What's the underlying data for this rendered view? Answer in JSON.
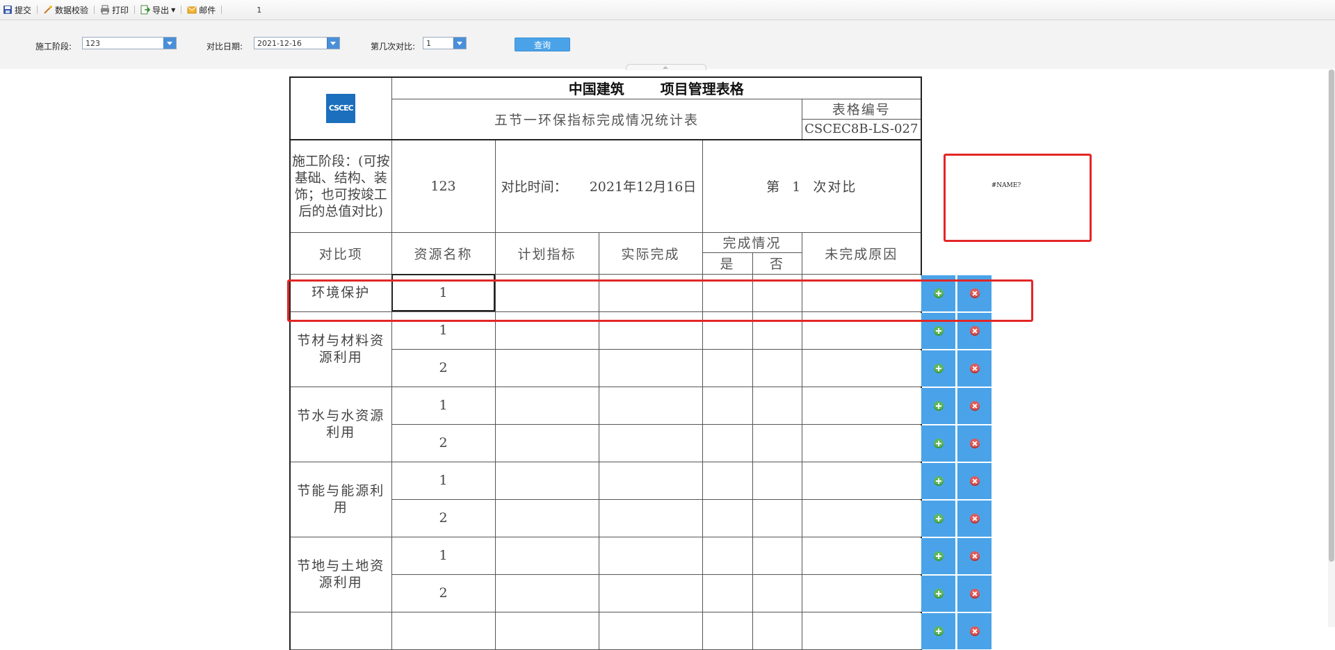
{
  "toolbar": {
    "items": [
      {
        "label": "提交",
        "icon": "save-icon"
      },
      {
        "label": "数据校验",
        "icon": "wand-icon"
      },
      {
        "label": "打印",
        "icon": "print-icon"
      },
      {
        "label": "导出",
        "icon": "export-icon"
      },
      {
        "label": "邮件",
        "icon": "mail-icon"
      }
    ],
    "page_number": "1"
  },
  "filters": {
    "stage_label": "施工阶段:",
    "stage_value": "123",
    "date_label": "对比日期:",
    "date_value": "2021-12-16",
    "round_label": "第几次对比:",
    "round_value": "1",
    "query_label": "查询"
  },
  "report": {
    "company": "中国建筑",
    "form_title": "项目管理表格",
    "logo_text": "CSCEC",
    "subtitle": "五节一环保指标完成情况统计表",
    "form_no_label": "表格编号",
    "form_no": "CSCEC8B-LS-027",
    "stage_desc": "施工阶段：(可按基础、结构、装饰；也可按竣工后的总值对比)",
    "stage_value": "123",
    "compare_time_label": "对比时间：",
    "compare_time": "2021年12月16日",
    "round_prefix": "第",
    "round_value": "1",
    "round_suffix": "次对比",
    "headers": {
      "item": "对比项",
      "resource": "资源名称",
      "plan": "计划指标",
      "actual": "实际完成",
      "status": "完成情况",
      "yes": "是",
      "no": "否",
      "reason": "未完成原因"
    },
    "categories": [
      {
        "name": "环境保护",
        "rows": [
          "1"
        ]
      },
      {
        "name": "节材与材料资源利用",
        "rows": [
          "1",
          "2"
        ]
      },
      {
        "name": "节水与水资源利用",
        "rows": [
          "1",
          "2"
        ]
      },
      {
        "name": "节能与能源利用",
        "rows": [
          "1",
          "2"
        ]
      },
      {
        "name": "节地与土地资源利用",
        "rows": [
          "1",
          "2"
        ]
      }
    ],
    "error_text": "#NAME?"
  },
  "colors": {
    "accent": "#4aa3e8",
    "annotation": "#e32626",
    "add": "#5cb85c",
    "delete": "#e05a5a"
  }
}
